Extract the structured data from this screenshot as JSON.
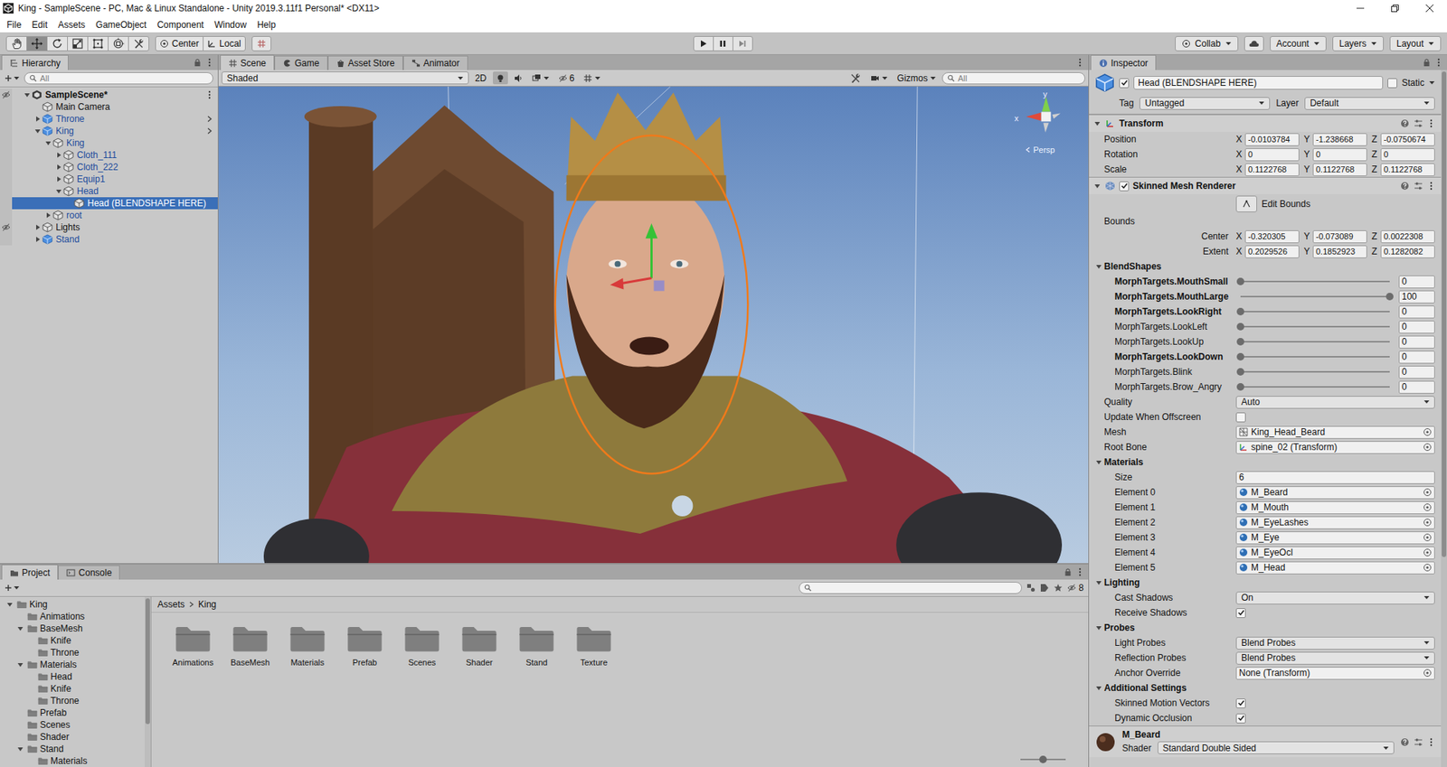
{
  "window": {
    "title": "King - SampleScene - PC, Mac & Linux Standalone - Unity 2019.3.11f1 Personal* <DX11>"
  },
  "menu": [
    "File",
    "Edit",
    "Assets",
    "GameObject",
    "Component",
    "Window",
    "Help"
  ],
  "toolbar": {
    "tools": [
      {
        "kind": "hand",
        "selected": false
      },
      {
        "kind": "move",
        "selected": true
      },
      {
        "kind": "rotate",
        "selected": false
      },
      {
        "kind": "scale",
        "selected": false
      },
      {
        "kind": "rect",
        "selected": false
      },
      {
        "kind": "transform",
        "selected": false
      },
      {
        "kind": "custom",
        "selected": false
      }
    ],
    "pivot": "Center",
    "space": "Local",
    "playback": [
      {
        "kind": "play",
        "disabled": false
      },
      {
        "kind": "pause",
        "disabled": false
      },
      {
        "kind": "step",
        "disabled": true
      }
    ],
    "collab": "Collab",
    "account": "Account",
    "layers": "Layers",
    "layout": "Layout"
  },
  "hierarchy": {
    "tab": "Hierarchy",
    "search": "All",
    "items": [
      {
        "label": "SampleScene*",
        "depth": 0,
        "kind": "scene",
        "has_children": true,
        "expanded": true,
        "selected": false,
        "hidden": true,
        "open_arrow": false
      },
      {
        "label": "Main Camera",
        "depth": 1,
        "kind": "object",
        "has_children": false,
        "expanded": false,
        "selected": false,
        "hidden": false,
        "open_arrow": false
      },
      {
        "label": "Throne",
        "depth": 1,
        "kind": "prefab",
        "has_children": true,
        "expanded": false,
        "selected": false,
        "hidden": false,
        "open_arrow": true
      },
      {
        "label": "King",
        "depth": 1,
        "kind": "prefab",
        "has_children": true,
        "expanded": true,
        "selected": false,
        "hidden": false,
        "open_arrow": true
      },
      {
        "label": "King",
        "depth": 2,
        "kind": "prefab-child",
        "has_children": true,
        "expanded": true,
        "selected": false,
        "hidden": false,
        "open_arrow": false
      },
      {
        "label": "Cloth_111",
        "depth": 3,
        "kind": "prefab-child",
        "has_children": true,
        "expanded": false,
        "selected": false,
        "hidden": false,
        "open_arrow": false
      },
      {
        "label": "Cloth_222",
        "depth": 3,
        "kind": "prefab-child",
        "has_children": true,
        "expanded": false,
        "selected": false,
        "hidden": false,
        "open_arrow": false
      },
      {
        "label": "Equip1",
        "depth": 3,
        "kind": "prefab-child",
        "has_children": true,
        "expanded": false,
        "selected": false,
        "hidden": false,
        "open_arrow": false
      },
      {
        "label": "Head",
        "depth": 3,
        "kind": "prefab-child",
        "has_children": true,
        "expanded": true,
        "selected": false,
        "hidden": false,
        "open_arrow": false
      },
      {
        "label": "Head (BLENDSHAPE HERE)",
        "depth": 4,
        "kind": "prefab-child",
        "has_children": false,
        "expanded": false,
        "selected": true,
        "hidden": false,
        "open_arrow": false
      },
      {
        "label": "root",
        "depth": 2,
        "kind": "prefab-child",
        "has_children": true,
        "expanded": false,
        "selected": false,
        "hidden": false,
        "open_arrow": false
      },
      {
        "label": "Lights",
        "depth": 1,
        "kind": "object",
        "has_children": true,
        "expanded": false,
        "selected": false,
        "hidden": true,
        "open_arrow": false
      },
      {
        "label": "Stand",
        "depth": 1,
        "kind": "prefab",
        "has_children": true,
        "expanded": false,
        "selected": false,
        "hidden": false,
        "open_arrow": false
      }
    ]
  },
  "scene": {
    "tabs": [
      {
        "label": "Scene",
        "kind": "scene",
        "selected": true
      },
      {
        "label": "Game",
        "kind": "game",
        "selected": false
      },
      {
        "label": "Asset Store",
        "kind": "store",
        "selected": false
      },
      {
        "label": "Animator",
        "kind": "animator",
        "selected": false
      }
    ],
    "shading": "Shaded",
    "mode_2d": "2D",
    "hidden_count": "6",
    "gizmos": "Gizmos",
    "search": "All",
    "axes": {
      "y": "y",
      "x": "x"
    },
    "projection": "Persp"
  },
  "inspector": {
    "tab": "Inspector",
    "object": {
      "active": true,
      "name": "Head (BLENDSHAPE HERE)",
      "static_label": "Static",
      "static": false,
      "tag_label": "Tag",
      "tag": "Untagged",
      "layer_label": "Layer",
      "layer": "Default"
    },
    "transform": {
      "title": "Transform",
      "expanded": true,
      "rows": [
        {
          "label": "Position",
          "values": [
            {
              "axis": "X",
              "value": "-0.0103784"
            },
            {
              "axis": "Y",
              "value": "-1.238668"
            },
            {
              "axis": "Z",
              "value": "-0.0750674"
            }
          ]
        },
        {
          "label": "Rotation",
          "values": [
            {
              "axis": "X",
              "value": "0"
            },
            {
              "axis": "Y",
              "value": "0"
            },
            {
              "axis": "Z",
              "value": "0"
            }
          ]
        },
        {
          "label": "Scale",
          "values": [
            {
              "axis": "X",
              "value": "0.1122768"
            },
            {
              "axis": "Y",
              "value": "0.1122768"
            },
            {
              "axis": "Z",
              "value": "0.1122768"
            }
          ]
        }
      ]
    },
    "renderer": {
      "title": "Skinned Mesh Renderer",
      "enabled": true,
      "expanded": true,
      "edit_bounds": "Edit Bounds",
      "bounds_label": "Bounds",
      "bounds": [
        {
          "label": "Center",
          "values": [
            {
              "axis": "X",
              "value": "-0.320305"
            },
            {
              "axis": "Y",
              "value": "-0.073089"
            },
            {
              "axis": "Z",
              "value": "0.0022308"
            }
          ]
        },
        {
          "label": "Extent",
          "values": [
            {
              "axis": "X",
              "value": "0.2029526"
            },
            {
              "axis": "Y",
              "value": "0.1852923"
            },
            {
              "axis": "Z",
              "value": "0.1282082"
            }
          ]
        }
      ],
      "blendshapes": {
        "label": "BlendShapes",
        "expanded": true,
        "items": [
          {
            "name": "MorphTargets.MouthSmall",
            "modified": true,
            "level": 0,
            "reading": "0"
          },
          {
            "name": "MorphTargets.MouthLarge",
            "modified": true,
            "level": 1,
            "reading": "100"
          },
          {
            "name": "MorphTargets.LookRight",
            "modified": true,
            "level": 0,
            "reading": "0"
          },
          {
            "name": "MorphTargets.LookLeft",
            "modified": false,
            "level": 0,
            "reading": "0"
          },
          {
            "name": "MorphTargets.LookUp",
            "modified": false,
            "level": 0,
            "reading": "0"
          },
          {
            "name": "MorphTargets.LookDown",
            "modified": true,
            "level": 0,
            "reading": "0"
          },
          {
            "name": "MorphTargets.Blink",
            "modified": false,
            "level": 0,
            "reading": "0"
          },
          {
            "name": "MorphTargets.Brow_Angry",
            "modified": false,
            "level": 0,
            "reading": "0"
          }
        ]
      },
      "fields": [
        {
          "label": "Quality",
          "kind": "dropdown",
          "value": "Auto"
        },
        {
          "label": "Update When Offscreen",
          "kind": "checkbox",
          "checked": false
        },
        {
          "label": "Mesh",
          "kind": "mesh-ref",
          "value": "King_Head_Beard"
        },
        {
          "label": "Root Bone",
          "kind": "bone-ref",
          "value": "spine_02 (Transform)"
        }
      ],
      "sections": [
        {
          "label": "Materials",
          "expanded": true,
          "fields": [
            {
              "label": "Size",
              "kind": "text",
              "value": "6"
            },
            {
              "label": "Element 0",
              "kind": "material-ref",
              "value": "M_Beard"
            },
            {
              "label": "Element 1",
              "kind": "material-ref",
              "value": "M_Mouth"
            },
            {
              "label": "Element 2",
              "kind": "material-ref",
              "value": "M_EyeLashes"
            },
            {
              "label": "Element 3",
              "kind": "material-ref",
              "value": "M_Eye"
            },
            {
              "label": "Element 4",
              "kind": "material-ref",
              "value": "M_EyeOcl"
            },
            {
              "label": "Element 5",
              "kind": "material-ref",
              "value": "M_Head"
            }
          ]
        },
        {
          "label": "Lighting",
          "expanded": true,
          "fields": [
            {
              "label": "Cast Shadows",
              "kind": "dropdown",
              "value": "On"
            },
            {
              "label": "Receive Shadows",
              "kind": "checkbox",
              "checked": true
            }
          ]
        },
        {
          "label": "Probes",
          "expanded": true,
          "fields": [
            {
              "label": "Light Probes",
              "kind": "dropdown",
              "value": "Blend Probes"
            },
            {
              "label": "Reflection Probes",
              "kind": "dropdown",
              "value": "Blend Probes"
            },
            {
              "label": "Anchor Override",
              "kind": "object-ref",
              "value": "None (Transform)"
            }
          ]
        },
        {
          "label": "Additional Settings",
          "expanded": true,
          "fields": [
            {
              "label": "Skinned Motion Vectors",
              "kind": "checkbox",
              "checked": true
            },
            {
              "label": "Dynamic Occlusion",
              "kind": "checkbox",
              "checked": true
            }
          ]
        }
      ]
    },
    "material": {
      "name": "M_Beard",
      "shader_label": "Shader",
      "shader": "Standard Double Sided"
    }
  },
  "project": {
    "tabs": [
      {
        "label": "Project",
        "kind": "project",
        "selected": true
      },
      {
        "label": "Console",
        "kind": "console",
        "selected": false
      }
    ],
    "hidden_count": "8",
    "tree": [
      {
        "label": "King",
        "depth": 0,
        "has_children": true,
        "expanded": true
      },
      {
        "label": "Animations",
        "depth": 1,
        "has_children": false,
        "expanded": false
      },
      {
        "label": "BaseMesh",
        "depth": 1,
        "has_children": true,
        "expanded": true
      },
      {
        "label": "Knife",
        "depth": 2,
        "has_children": false,
        "expanded": false
      },
      {
        "label": "Throne",
        "depth": 2,
        "has_children": false,
        "expanded": false
      },
      {
        "label": "Materials",
        "depth": 1,
        "has_children": true,
        "expanded": true
      },
      {
        "label": "Head",
        "depth": 2,
        "has_children": false,
        "expanded": false
      },
      {
        "label": "Knife",
        "depth": 2,
        "has_children": false,
        "expanded": false
      },
      {
        "label": "Throne",
        "depth": 2,
        "has_children": false,
        "expanded": false
      },
      {
        "label": "Prefab",
        "depth": 1,
        "has_children": false,
        "expanded": false
      },
      {
        "label": "Scenes",
        "depth": 1,
        "has_children": false,
        "expanded": false
      },
      {
        "label": "Shader",
        "depth": 1,
        "has_children": false,
        "expanded": false
      },
      {
        "label": "Stand",
        "depth": 1,
        "has_children": true,
        "expanded": true
      },
      {
        "label": "Materials",
        "depth": 2,
        "has_children": false,
        "expanded": false
      }
    ],
    "breadcrumb": [
      "Assets",
      "King"
    ],
    "folders": [
      "Animations",
      "BaseMesh",
      "Materials",
      "Prefab",
      "Scenes",
      "Shader",
      "Stand",
      "Texture"
    ],
    "zoom_level": 0.5
  }
}
